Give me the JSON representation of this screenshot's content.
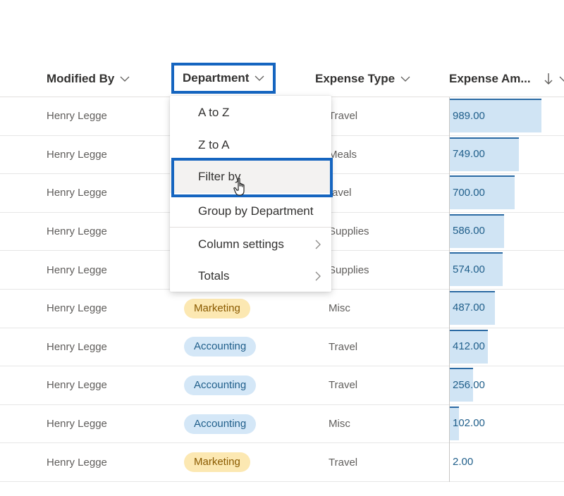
{
  "columns": {
    "modified_by": "Modified By",
    "department": "Department",
    "expense_type": "Expense Type",
    "expense_amount": "Expense Am..."
  },
  "icons": {
    "column_menu": "chevron-down-icon",
    "sort": "arrow-down-icon",
    "submenu": "chevron-right-icon",
    "cursor": "hand-pointer-icon"
  },
  "colors": {
    "highlight_border": "#1565c0",
    "marketing_pill": "#fce8b2",
    "accounting_pill": "#d4e7f7",
    "data_bar": "#d0e4f4"
  },
  "menu": {
    "a_to_z": "A to Z",
    "z_to_a": "Z to A",
    "filter_by": "Filter by",
    "group_by": "Group by Department",
    "column_settings": "Column settings",
    "totals": "Totals"
  },
  "rows": [
    {
      "modified_by": "Henry Legge",
      "department": "",
      "expense_type": "Travel",
      "expense_amount": "989.00",
      "amount": 989.0
    },
    {
      "modified_by": "Henry Legge",
      "department": "",
      "expense_type": "Meals",
      "expense_amount": "749.00",
      "amount": 749.0
    },
    {
      "modified_by": "Henry Legge",
      "department": "",
      "expense_type": "ravel",
      "expense_amount": "700.00",
      "amount": 700.0
    },
    {
      "modified_by": "Henry Legge",
      "department": "",
      "expense_type": "Supplies",
      "expense_amount": "586.00",
      "amount": 586.0
    },
    {
      "modified_by": "Henry Legge",
      "department": "",
      "expense_type": "Supplies",
      "expense_amount": "574.00",
      "amount": 574.0
    },
    {
      "modified_by": "Henry Legge",
      "department": "Marketing",
      "expense_type": "Misc",
      "expense_amount": "487.00",
      "amount": 487.0
    },
    {
      "modified_by": "Henry Legge",
      "department": "Accounting",
      "expense_type": "Travel",
      "expense_amount": "412.00",
      "amount": 412.0
    },
    {
      "modified_by": "Henry Legge",
      "department": "Accounting",
      "expense_type": "Travel",
      "expense_amount": "256.00",
      "amount": 256.0
    },
    {
      "modified_by": "Henry Legge",
      "department": "Accounting",
      "expense_type": "Misc",
      "expense_amount": "102.00",
      "amount": 102.0
    },
    {
      "modified_by": "Henry Legge",
      "department": "Marketing",
      "expense_type": "Travel",
      "expense_amount": "2.00",
      "amount": 2.0
    }
  ]
}
